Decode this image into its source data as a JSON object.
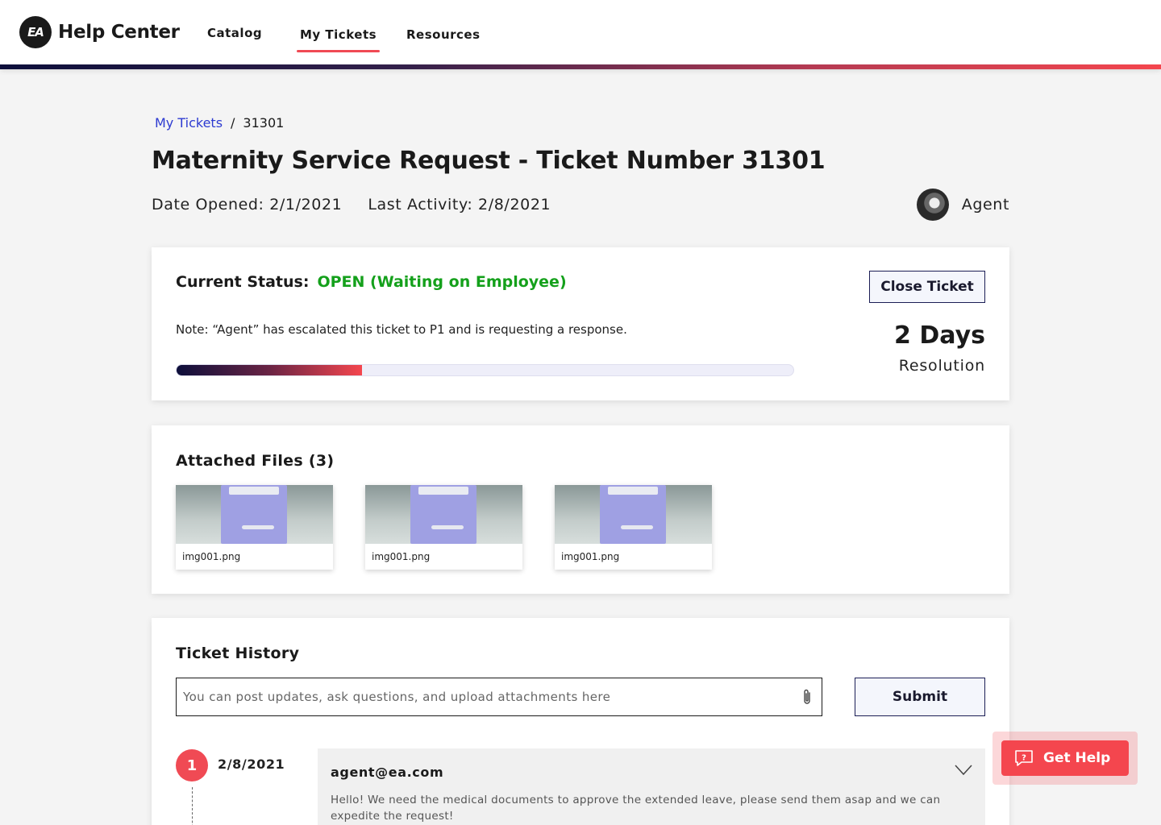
{
  "header": {
    "brand_logo": "EA",
    "brand_title": "Help Center",
    "nav": [
      {
        "label": "Catalog",
        "active": false
      },
      {
        "label": "My Tickets",
        "active": true
      },
      {
        "label": "Resources",
        "active": false
      }
    ],
    "accent_gradient": [
      "#0d0f3b",
      "#f4464e"
    ]
  },
  "breadcrumb": {
    "link": "My Tickets",
    "separator": "/",
    "current": "31301"
  },
  "ticket": {
    "title": "Maternity Service Request - Ticket Number 31301",
    "date_opened": "Date Opened: 2/1/2021",
    "last_activity": "Last Activity: 2/8/2021",
    "assignee_label": "Agent"
  },
  "status": {
    "label": "Current Status:",
    "value": "OPEN (Waiting on Employee)",
    "value_color": "#14a01b",
    "note": "Note: “Agent” has escalated this ticket to P1 and is requesting a response.",
    "progress_percent": 30,
    "close_button": "Close Ticket",
    "resolution_value": "2 Days",
    "resolution_label": "Resolution"
  },
  "files": {
    "heading": "Attached Files (3)",
    "items": [
      {
        "name": "img001.png"
      },
      {
        "name": "img001.png"
      },
      {
        "name": "img001.png"
      }
    ]
  },
  "history": {
    "heading": "Ticket History",
    "input_placeholder": "You can post updates, ask questions, and upload attachments here",
    "input_value": "",
    "attach_icon": "paperclip-icon",
    "submit_button": "Submit",
    "entries": [
      {
        "step": "1",
        "date": "2/8/2021",
        "from": "agent@ea.com",
        "body": "Hello! We need the medical documents to approve the extended leave, please send them asap and we can expedite the request!"
      }
    ]
  },
  "get_help": {
    "label": "Get Help",
    "icon": "help-chat-icon",
    "color": "#f4464e"
  }
}
